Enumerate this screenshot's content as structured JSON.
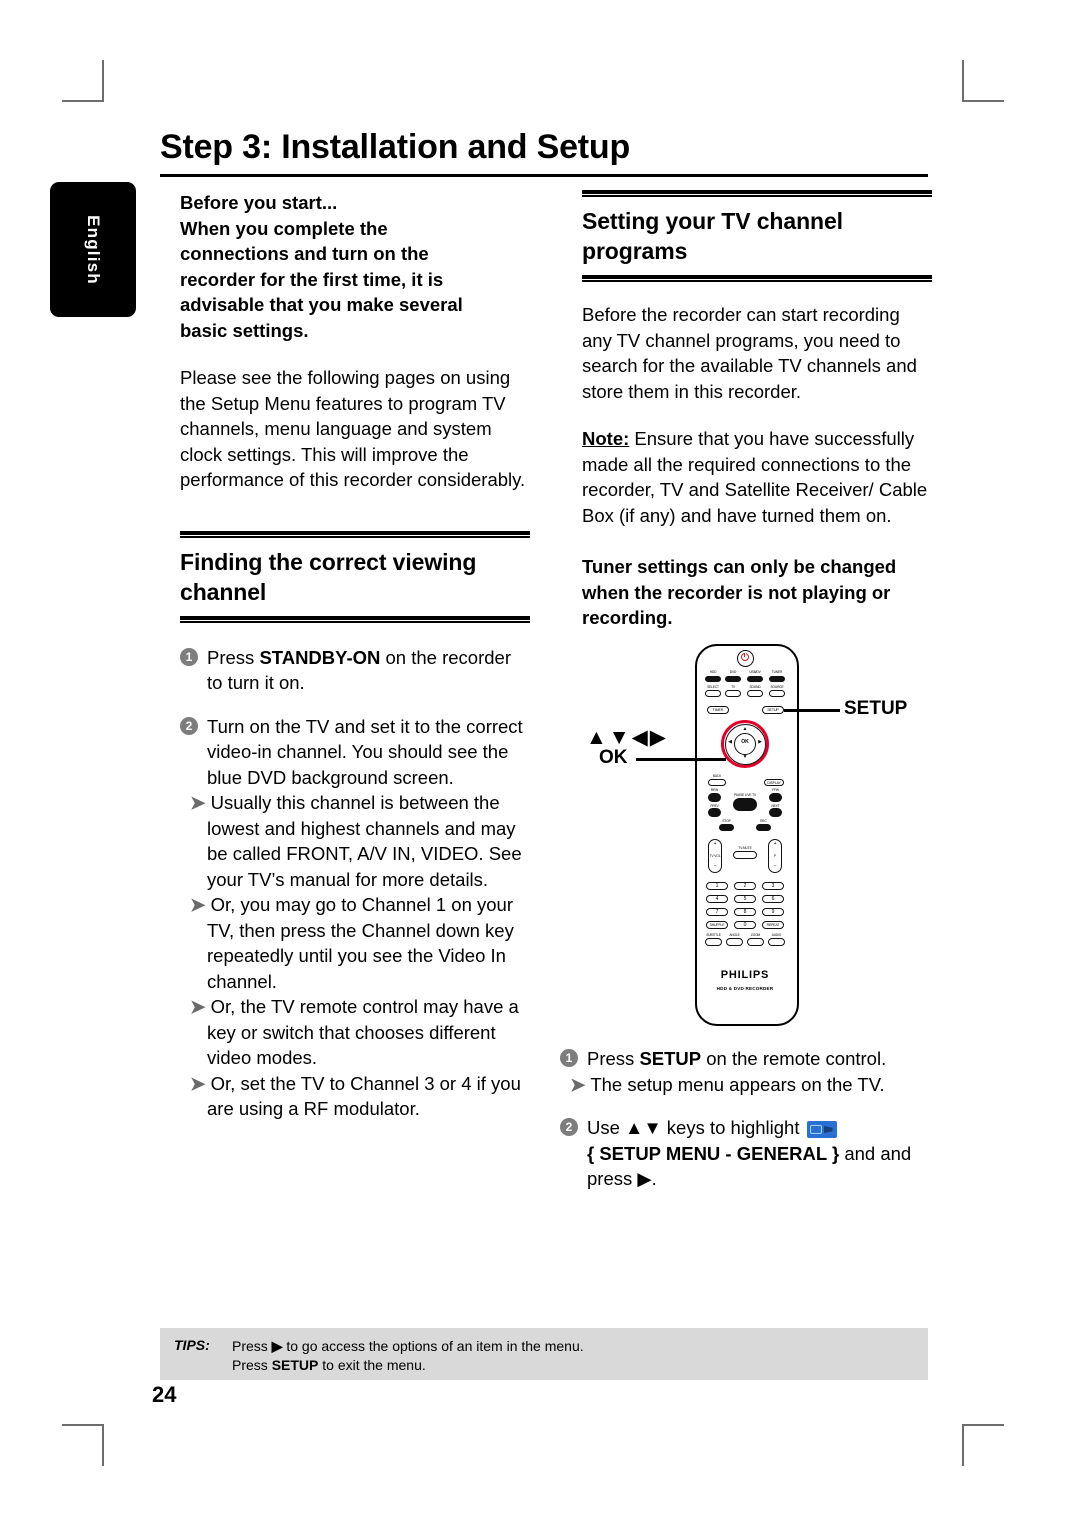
{
  "page": {
    "title": "Step 3: Installation and Setup",
    "language_tab": "English",
    "page_number": "24"
  },
  "left_column": {
    "before_you_start": {
      "lines": [
        "Before you start...",
        "When you complete the",
        "connections and turn on the",
        "recorder for the first time, it is",
        "advisable that you make several",
        "basic settings."
      ],
      "text": "Before you start... When you complete the connections and turn on the recorder for the first time, it is advisable that you make several basic settings."
    },
    "intro_paragraph": "Please see the following pages on using the Setup Menu features to program TV channels, menu language and system clock settings. This will improve the performance of this recorder considerably.",
    "section": {
      "heading": "Finding the correct viewing channel",
      "steps": [
        {
          "number": "1",
          "text_before": "Press ",
          "key": "STANDBY-ON",
          "text_after": " on the recorder to turn it on.",
          "sub_items": []
        },
        {
          "number": "2",
          "text_before": "",
          "key": "",
          "text_after": "Turn on the TV and set it to the correct video-in channel. You should see the blue DVD background screen.",
          "sub_items": [
            "Usually this channel is between the lowest and highest channels and may be called FRONT, A/V IN, VIDEO. See your TV’s manual for more details.",
            "Or, you may go to Channel 1 on your TV, then press the Channel down key repeatedly until you see the Video In channel.",
            "Or, the TV remote control may have a key or switch that chooses different video modes.",
            "Or, set the TV to Channel 3 or 4 if you are using a RF modulator."
          ]
        }
      ]
    }
  },
  "right_column": {
    "section": {
      "heading": "Setting your TV channel programs"
    },
    "intro_paragraph": "Before the recorder can start recording any TV channel programs, you need to search for the available TV channels and store them in this recorder.",
    "note": {
      "label": "Note:",
      "text": " Ensure that you have successfully made all the required connections to the recorder, TV and Satellite Receiver/ Cable Box (if any) and have turned them on."
    },
    "warning": "Tuner settings can only be changed when the recorder is not playing or recording.",
    "steps": [
      {
        "number": "1",
        "text_before": "Press ",
        "key": "SETUP",
        "text_after": " on the remote control.",
        "sub_items": [
          "The setup menu appears on the TV."
        ]
      },
      {
        "number": "2",
        "text_before": "Use ",
        "keys_glyph": "▲▼",
        "text_mid": " keys to highlight ",
        "menu_item": "{ SETUP MENU - GENERAL }",
        "text_after": " and and press ▶."
      }
    ]
  },
  "remote": {
    "callouts": {
      "setup": "SETUP",
      "ok": "OK",
      "arrows": "▲▼◀▶"
    },
    "brand": "PHILIPS",
    "brand_sub": "HDD & DVD RECORDER",
    "source_buttons": [
      "HDD",
      "DVD",
      "USB/DV",
      "TUNER"
    ],
    "source_buttons_row2": [
      "SELECT",
      "TV",
      "SOUND",
      "SOURCE"
    ],
    "top_buttons": [
      "TIMER",
      "SETUP"
    ],
    "nav": {
      "up": "▲",
      "down": "▼",
      "left": "◀",
      "right": "▶",
      "center": "OK"
    },
    "transport_row": [
      "BACK",
      "DISPLAY"
    ],
    "transport_buttons": [
      "REW",
      "PAUSE LIVE TV",
      "FFW",
      "PREV",
      "NEXT",
      "STOP",
      "REC"
    ],
    "volume": [
      "+",
      "TV VOL",
      "−",
      "TV-MUTE",
      "+",
      "P",
      "−"
    ],
    "keypad": [
      "1",
      "2",
      "3",
      "4",
      "5",
      "6",
      "7",
      "8",
      "9",
      "SHUFFLE",
      "0",
      "REPEAT"
    ],
    "bottom_buttons": [
      "SUBTITLE",
      "ANGLE",
      "ZOOM",
      "AUDIO"
    ]
  },
  "tips": {
    "label": "TIPS:",
    "line1_before": "Press ",
    "line1_glyph": "▶",
    "line1_after": " to go access the options of an item in the menu.",
    "line2_before": "Press ",
    "line2_key": "SETUP",
    "line2_after": " to exit the menu."
  },
  "colors": {
    "accent_red": "#e4002b",
    "tips_bg": "#d9d9d9",
    "step_bullet": "#7d7d7d",
    "icon_blue": "#2a6fd4"
  }
}
